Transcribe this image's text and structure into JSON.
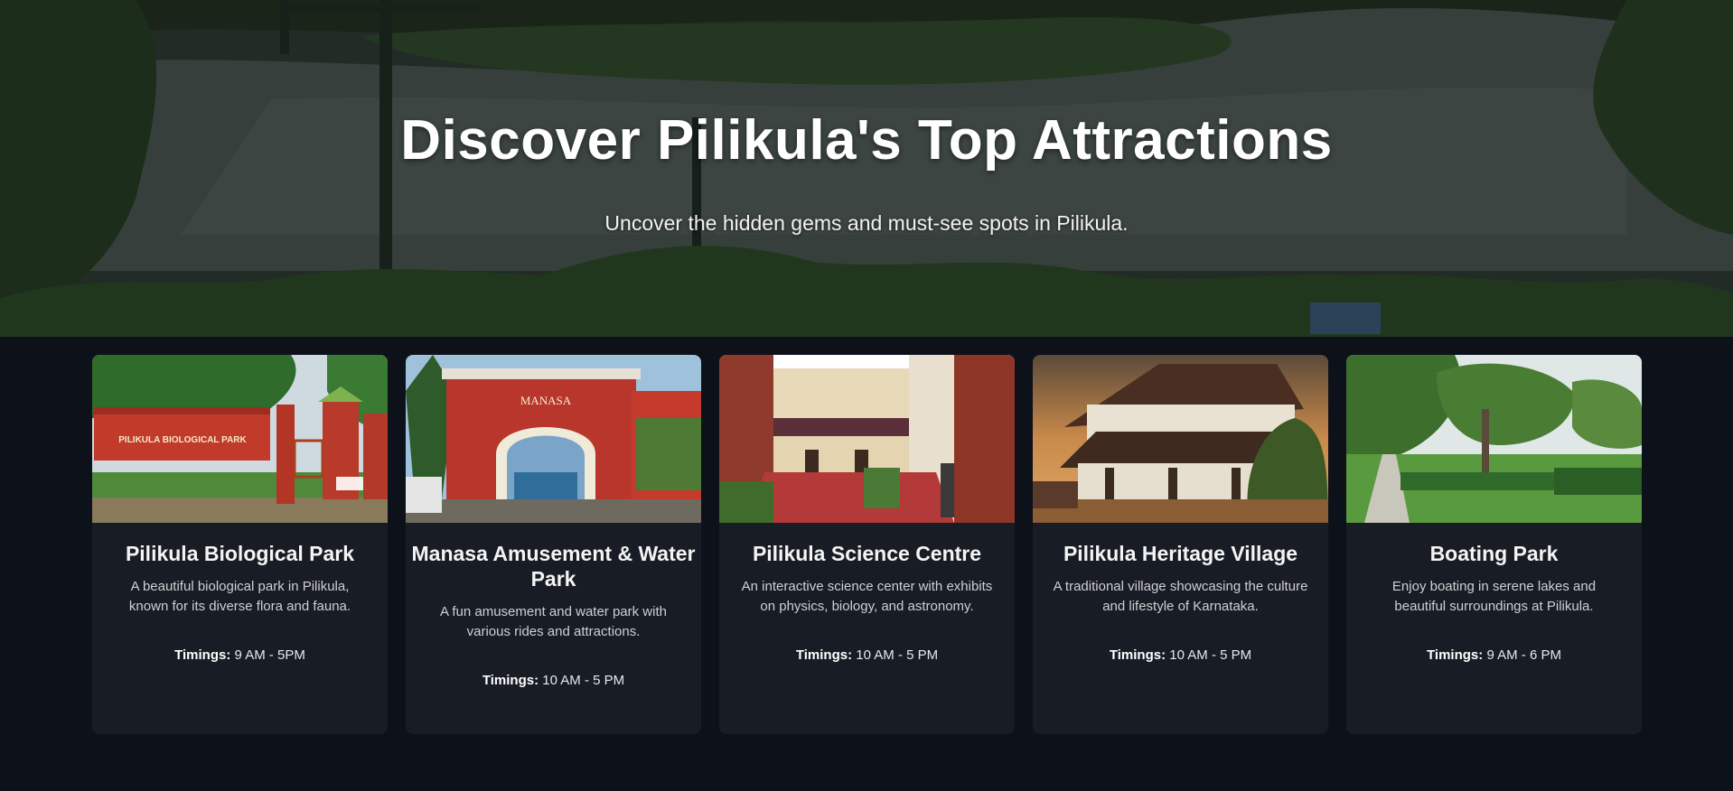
{
  "hero": {
    "title": "Discover Pilikula's Top Attractions",
    "subtitle": "Uncover the hidden gems and must-see spots in Pilikula."
  },
  "cards": [
    {
      "title": "Pilikula Biological Park",
      "description": "A beautiful biological park in Pilikula, known for its diverse flora and fauna.",
      "timings_label": "Timings:",
      "timings_value": "9 AM - 5PM",
      "image_sign_text": "PILIKULA BIOLOGICAL PARK"
    },
    {
      "title": "Manasa Amusement & Water Park",
      "description": "A fun amusement and water park with various rides and attractions.",
      "timings_label": "Timings:",
      "timings_value": "10 AM - 5 PM",
      "image_sign_text": "MANASA"
    },
    {
      "title": "Pilikula Science Centre",
      "description": "An interactive science center with exhibits on physics, biology, and astronomy.",
      "timings_label": "Timings:",
      "timings_value": "10 AM - 5 PM"
    },
    {
      "title": "Pilikula Heritage Village",
      "description": "A traditional village showcasing the culture and lifestyle of Karnataka.",
      "timings_label": "Timings:",
      "timings_value": "10 AM - 5 PM"
    },
    {
      "title": "Boating Park",
      "description": "Enjoy boating in serene lakes and beautiful surroundings at Pilikula.",
      "timings_label": "Timings:",
      "timings_value": "9 AM - 6 PM"
    }
  ],
  "colors": {
    "page_background": "#0d1119",
    "card_background": "#181c25",
    "title_text": "#ffffff"
  }
}
